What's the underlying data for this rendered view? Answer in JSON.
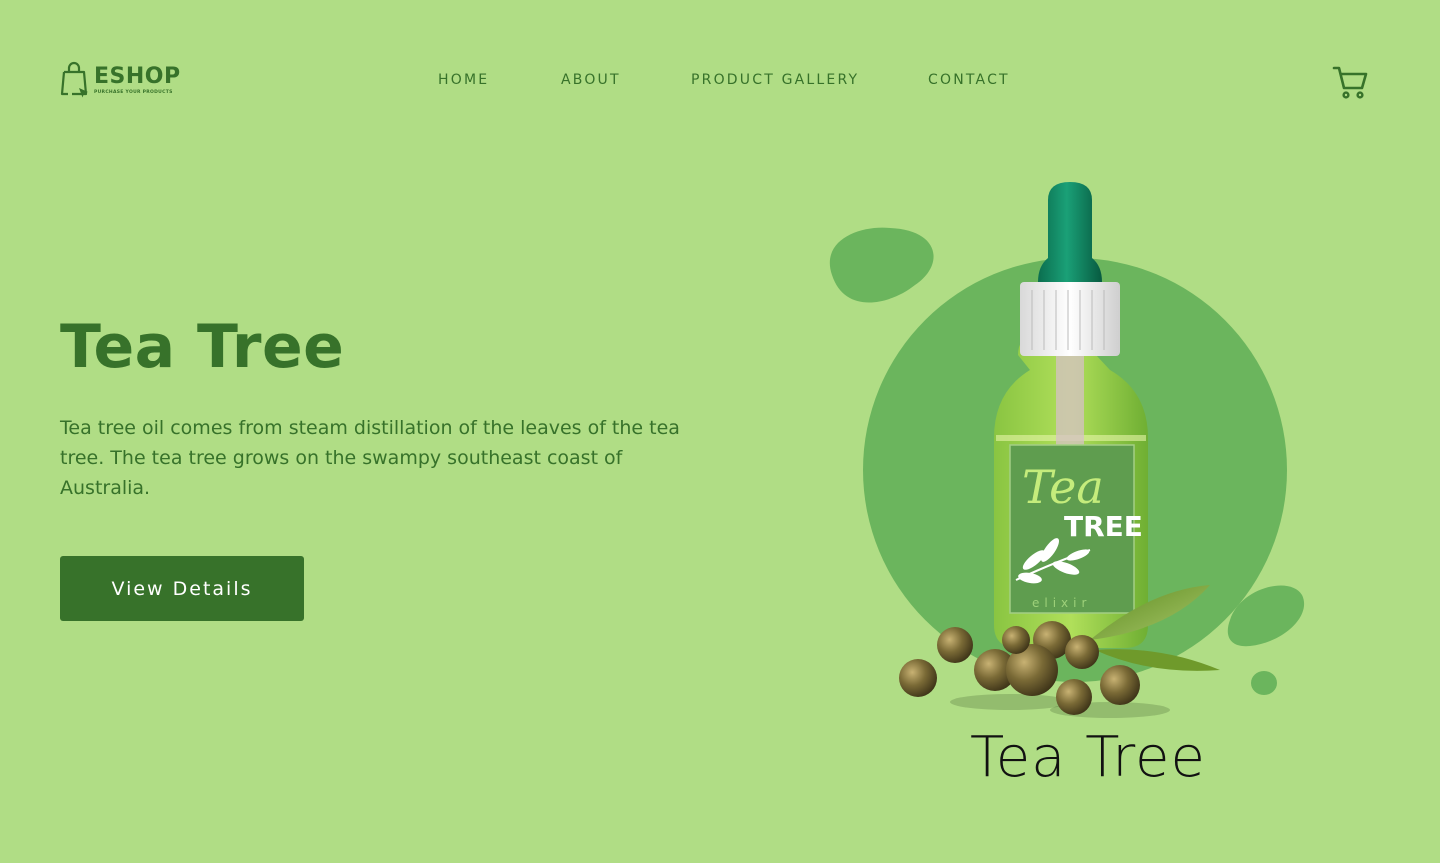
{
  "header": {
    "logo": {
      "name": "ESHOP",
      "tagline": "PURCHASE YOUR PRODUCTS",
      "icon": "shopping-bag-cursor-icon"
    },
    "nav": [
      {
        "label": "HOME"
      },
      {
        "label": "ABOUT"
      },
      {
        "label": "PRODUCT GALLERY"
      },
      {
        "label": "CONTACT"
      }
    ],
    "cart_icon": "cart-icon"
  },
  "hero": {
    "title": "Tea Tree",
    "description": "Tea tree oil comes from steam distillation of the leaves of the tea tree. The tea tree grows on the swampy southeast coast of Australia.",
    "button_label": "View Details"
  },
  "product": {
    "label_script": "Tea",
    "label_word": "TREE",
    "label_sub": "elixir",
    "caption": "Tea Tree"
  },
  "colors": {
    "background": "#b0dd85",
    "primary": "#37722a",
    "circle": "#6bb55d"
  }
}
